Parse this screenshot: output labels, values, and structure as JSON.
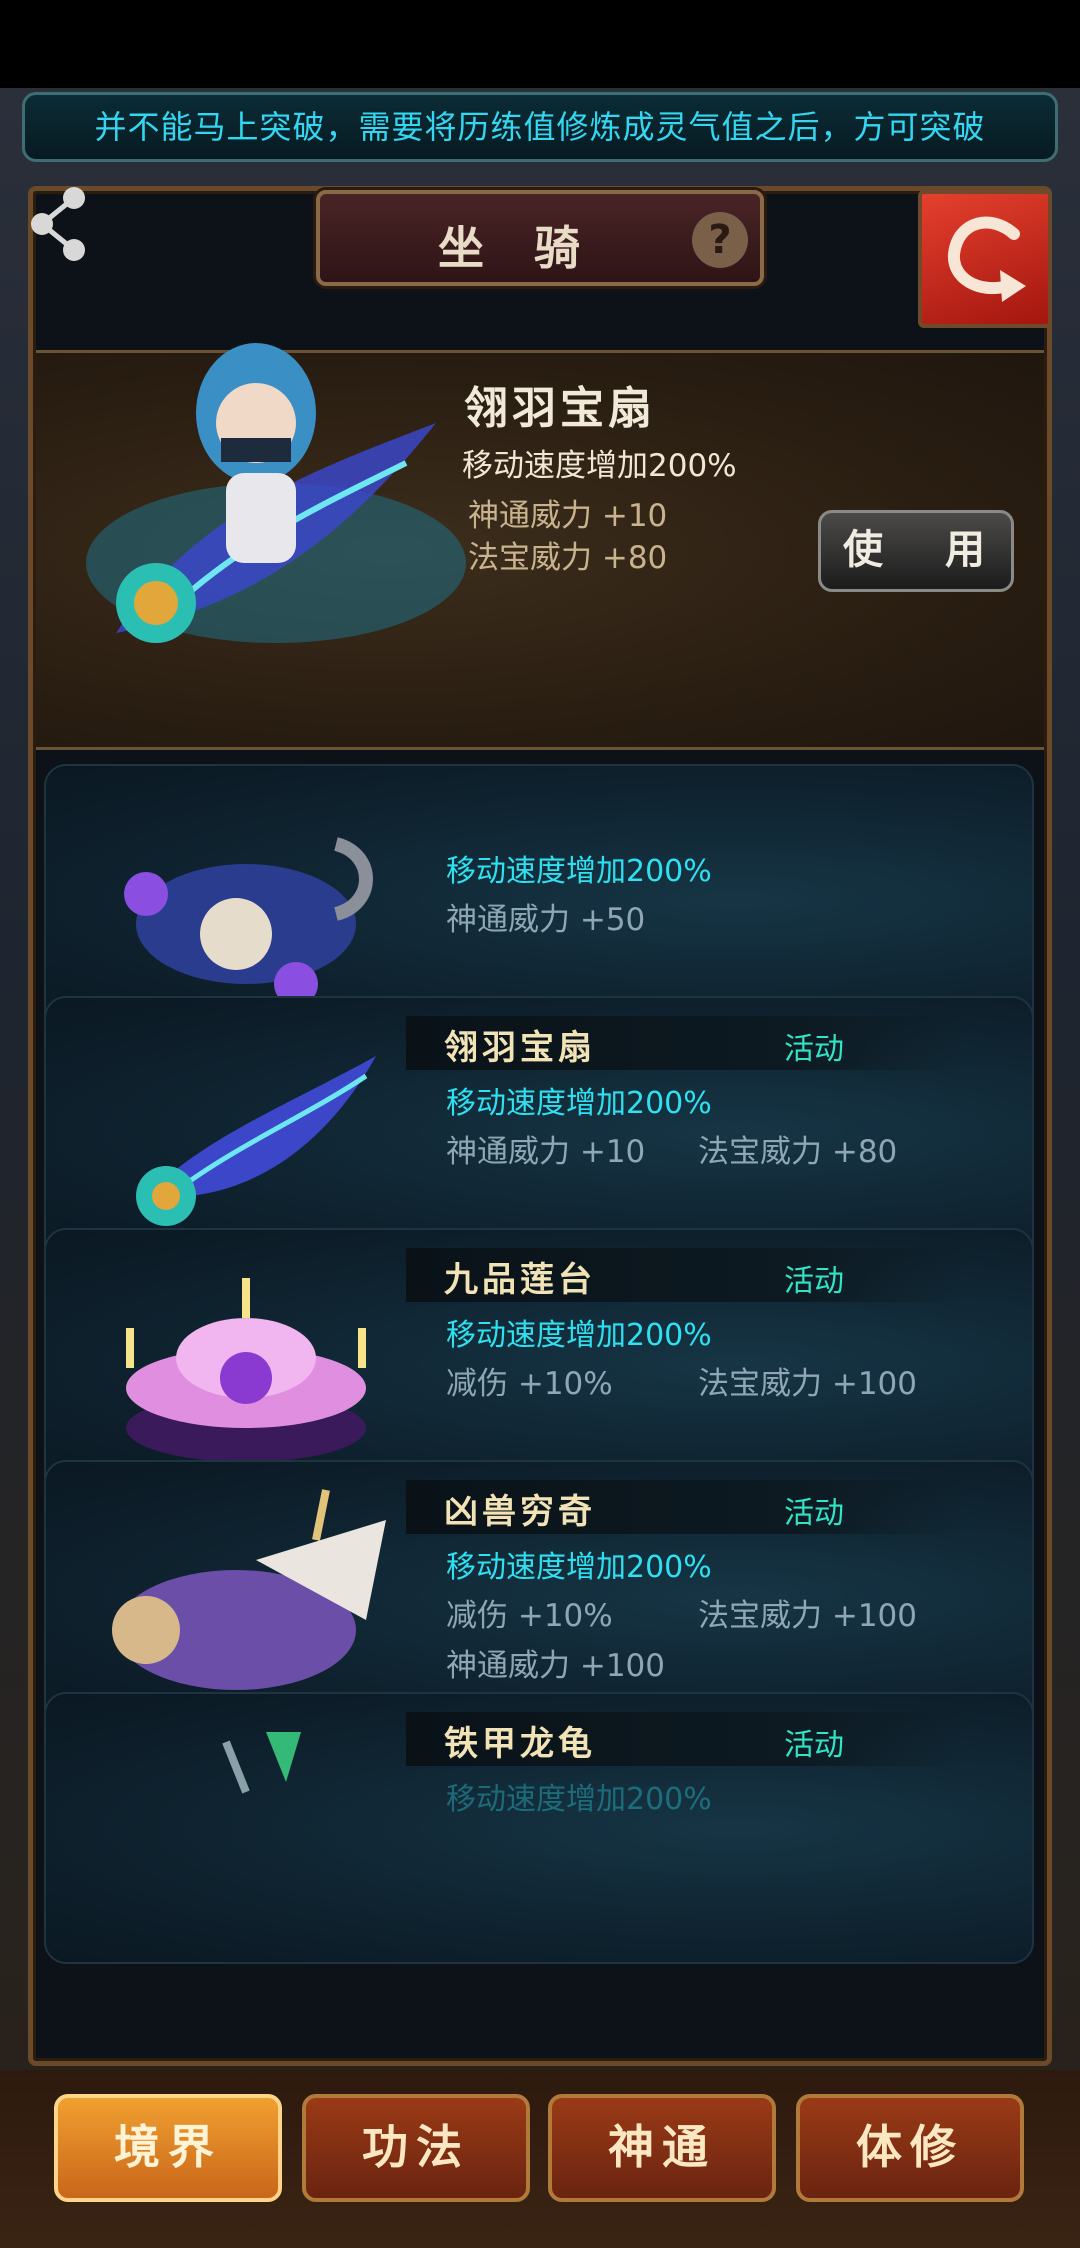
{
  "notice": "并不能马上突破，需要将历练值修炼成灵气值之后，方可突破",
  "panel": {
    "title": "坐骑",
    "help": "?"
  },
  "featured": {
    "name": "翎羽宝扇",
    "stat_speed": "移动速度增加200%",
    "stat_a": "神通威力  +10",
    "stat_b": "法宝威力  +80",
    "use_label": "使 用"
  },
  "mounts": [
    {
      "name": "",
      "tag": "",
      "speed": "移动速度增加200%",
      "stats": [
        "神通威力  +50"
      ]
    },
    {
      "name": "翎羽宝扇",
      "tag": "活动",
      "speed": "移动速度增加200%",
      "stats": [
        "神通威力  +10",
        "法宝威力  +80"
      ]
    },
    {
      "name": "九品莲台",
      "tag": "活动",
      "speed": "移动速度增加200%",
      "stats": [
        "减伤  +10%",
        "法宝威力  +100"
      ]
    },
    {
      "name": "凶兽穷奇",
      "tag": "活动",
      "speed": "移动速度增加200%",
      "stats": [
        "减伤  +10%",
        "法宝威力  +100",
        "神通威力  +100"
      ]
    },
    {
      "name": "铁甲龙龟",
      "tag": "活动",
      "speed": "移动速度增加200%",
      "stats": []
    }
  ],
  "nav": [
    "境界",
    "功法",
    "神通",
    "体修"
  ],
  "colors": {
    "accent_cyan": "#2fe0f0",
    "gold": "#f1e3b5",
    "active_tab": "#f0a030"
  }
}
